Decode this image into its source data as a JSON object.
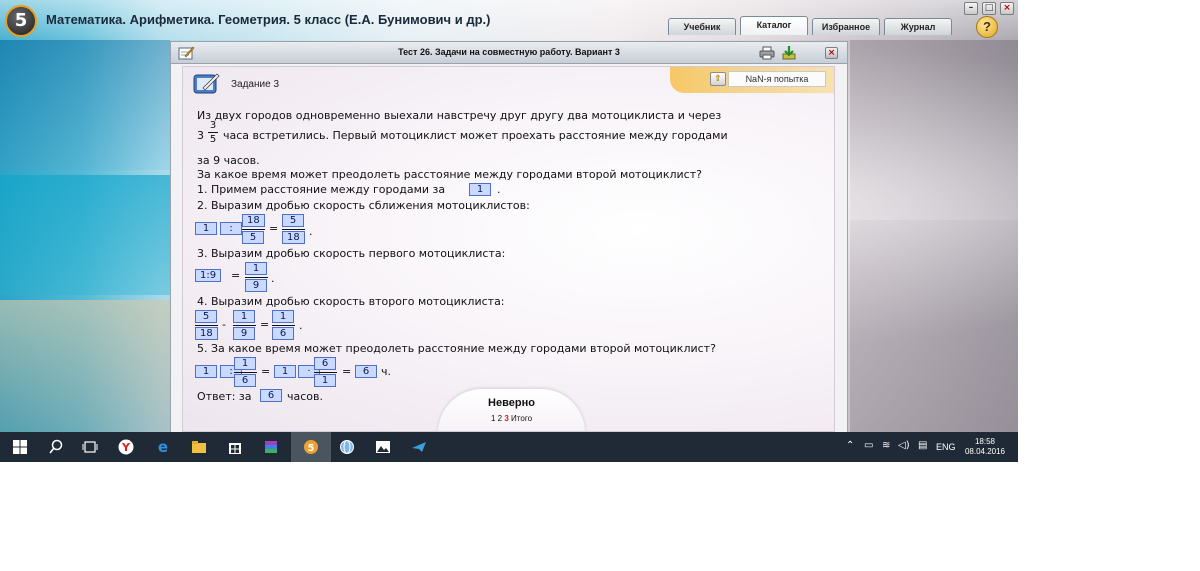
{
  "app": {
    "logo_number": "5",
    "title": "Математика. Арифметика. Геометрия. 5 класс (Е.А. Бунимович и др.)",
    "tabs": [
      {
        "label": "Учебник"
      },
      {
        "label": "Каталог",
        "active": true
      },
      {
        "label": "Избранное"
      },
      {
        "label": "Журнал"
      }
    ],
    "help_label": "?"
  },
  "test": {
    "title": "Тест 26. Задачи на совместную работу. Вариант 3",
    "task_label": "Задание 3",
    "attempt": "NaN-я попытка",
    "problem": {
      "line1": "Из двух городов одновременно выехали навстречу друг другу два мотоциклиста и через",
      "mixed_whole": "3",
      "mixed_num": "3",
      "mixed_den": "5",
      "line2_rest": "часа встретились. Первый мотоциклист может проехать расстояние между городами",
      "line3": "за 9 часов.",
      "line4": "За какое время может преодолеть расстояние между городами второй мотоциклист?"
    },
    "steps": {
      "s1_text": "1. Примем расстояние между городами за",
      "s1_box": "1",
      "s1_end": ".",
      "s2_text": "2. Выразим дробью скорость сближения мотоциклистов:",
      "s2": {
        "a": "1",
        "op": ":",
        "b_num": "18",
        "b_den": "5",
        "eq": "=",
        "r_num": "5",
        "r_den": "18",
        "end": "."
      },
      "s3_text": "3. Выразим дробью скорость первого мотоциклиста:",
      "s3": {
        "a": "1:9",
        "eq": "=",
        "r_num": "1",
        "r_den": "9",
        "end": "."
      },
      "s4_text": "4. Выразим дробью скорость второго мотоциклиста:",
      "s4": {
        "a_num": "5",
        "a_den": "18",
        "minus": "-",
        "b_num": "1",
        "b_den": "9",
        "eq": "=",
        "r_num": "1",
        "r_den": "6",
        "end": "."
      },
      "s5_text": "5. За какое время может преодолеть расстояние между городами второй мотоциклист?",
      "s5": {
        "a": "1",
        "op": ":",
        "b_num": "1",
        "b_den": "6",
        "eq": "=",
        "c": "1",
        "dot": "·",
        "d_num": "6",
        "d_den": "1",
        "eq2": "=",
        "r": "6",
        "unit": "ч."
      },
      "answer_prefix": "Ответ: за",
      "answer_box": "6",
      "answer_suffix": "часов."
    },
    "result": "Неверно",
    "pages": {
      "p1": "1",
      "p2": "2",
      "p3": "3",
      "total": "Итого"
    }
  },
  "taskbar": {
    "lang": "ENG",
    "time": "18:58",
    "date": "08.04.2016"
  },
  "colors": {
    "input_fill": "#c9d9ff",
    "input_border": "#4f6fc8",
    "taskbar": "#1f2a36",
    "attempt_bar": "#f4d38b"
  }
}
